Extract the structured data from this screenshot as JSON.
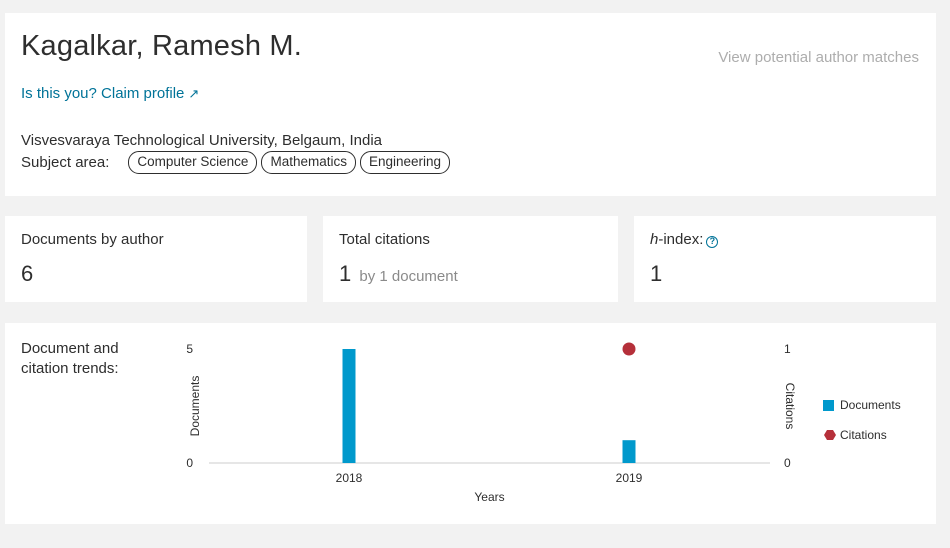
{
  "profile": {
    "name": "Kagalkar, Ramesh M.",
    "potential_matches": "View potential author matches",
    "claim": "Is this you? Claim profile",
    "claim_icon": "↗",
    "affiliation": "Visvesvaraya Technological University, Belgaum, India",
    "subject_label": "Subject area:",
    "subjects": [
      "Computer Science",
      "Mathematics",
      "Engineering"
    ]
  },
  "metrics": {
    "documents": {
      "label": "Documents by author",
      "value": "6"
    },
    "citations": {
      "label": "Total citations",
      "value": "1",
      "sub": "by 1 document"
    },
    "hindex": {
      "label_italic": "h",
      "label_rest": "-index:",
      "value": "1",
      "help_icon": "?"
    }
  },
  "trends": {
    "label": "Document and citation trends:"
  },
  "chart_data": {
    "type": "bar",
    "categories": [
      "2018",
      "2019"
    ],
    "xlabel": "Years",
    "ylabel": "Documents",
    "y2label": "Citations",
    "ylim": [
      0,
      5
    ],
    "y2lim": [
      0,
      1
    ],
    "yticks": [
      "0",
      "5"
    ],
    "y2ticks": [
      "0",
      "1"
    ],
    "series": [
      {
        "name": "Documents",
        "kind": "bar",
        "axis": "left",
        "color": "#0099cc",
        "values": [
          5,
          1
        ]
      },
      {
        "name": "Citations",
        "kind": "point",
        "axis": "right",
        "color": "#b5303a",
        "values": [
          0,
          1
        ]
      }
    ],
    "legend": "right"
  }
}
